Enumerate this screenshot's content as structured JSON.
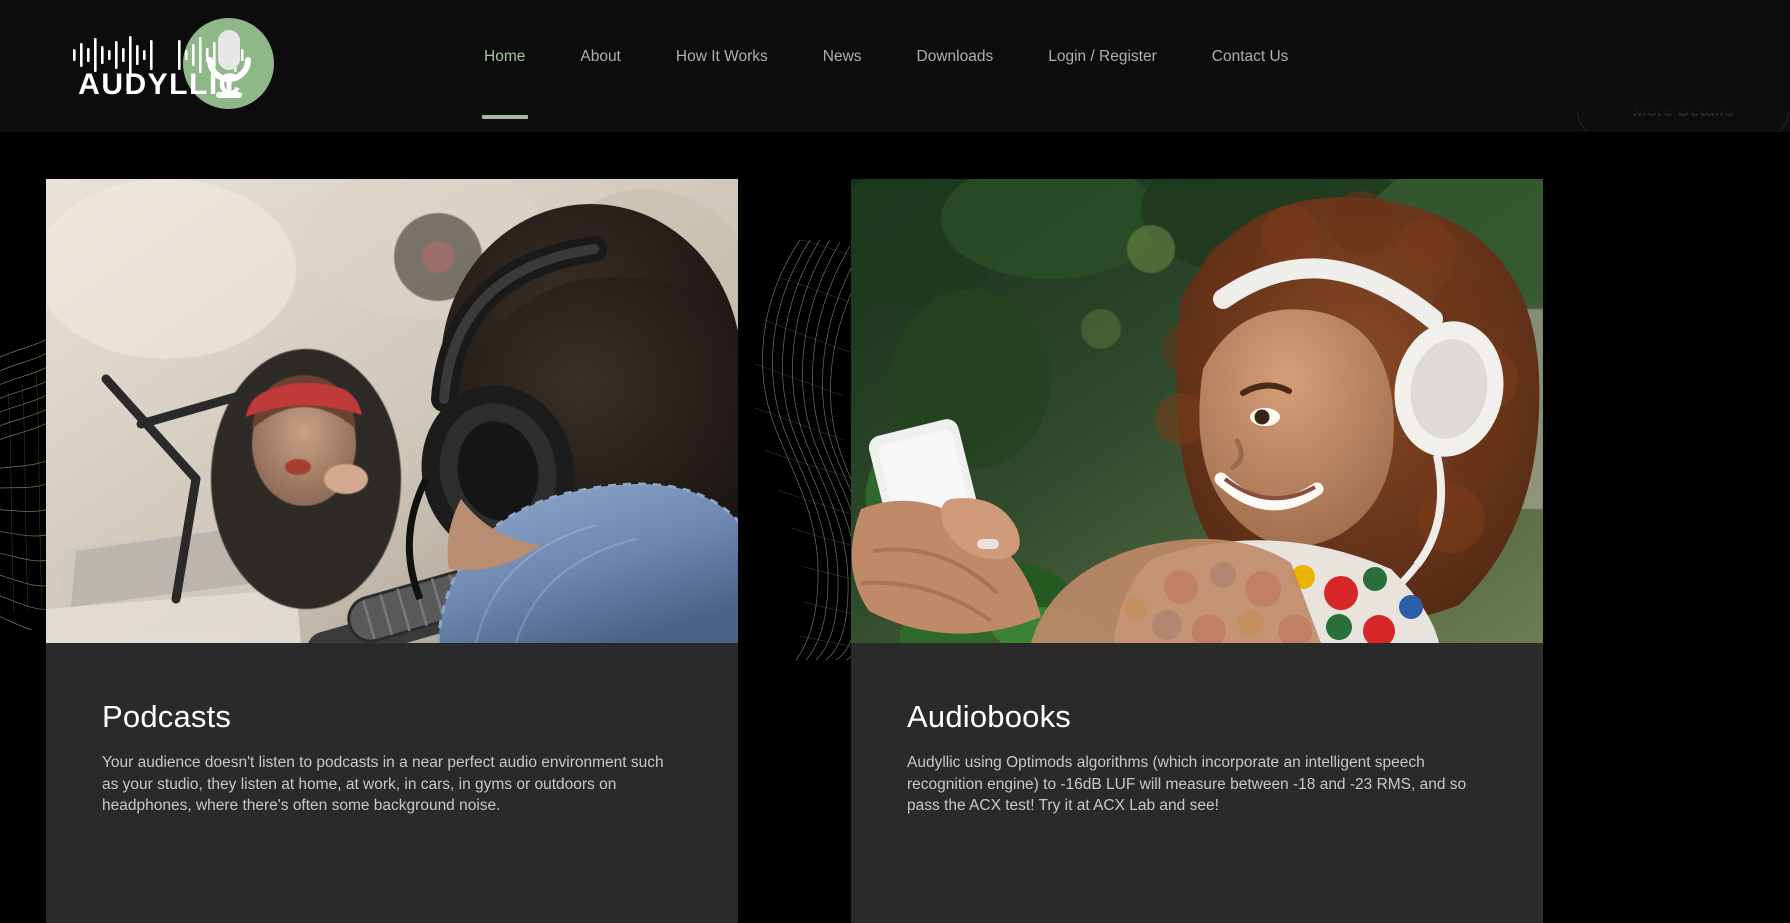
{
  "brand": {
    "name": "AUDYLLIC",
    "logo_icon": "microphone-waveform-icon",
    "accent_green": "#8fb888",
    "circle_color": "#8fb888"
  },
  "header": {
    "nav": [
      {
        "label": "Home",
        "active": true
      },
      {
        "label": "About",
        "active": false
      },
      {
        "label": "How It Works",
        "active": false
      },
      {
        "label": "News",
        "active": false
      },
      {
        "label": "Downloads",
        "active": false
      },
      {
        "label": "Login / Register",
        "active": false
      },
      {
        "label": "Contact Us",
        "active": false
      }
    ],
    "active_color": "#a8c5a0",
    "inactive_color": "#aeb0ad",
    "underline_color": "#9fbd98"
  },
  "hero": {
    "heading": "Don't Lose Your Hard-Won Audience!",
    "button_label": "More Details",
    "heading_color": "#1a1a18",
    "background": "#0d0d0d"
  },
  "cards": [
    {
      "title": "Podcasts",
      "body": "Your audience doesn't listen to podcasts in a near perfect audio environment such as your studio, they listen at home, at work, in cars, in gyms or outdoors on headphones, where there's often some background noise.",
      "image_alt": "podcast-studio-photo",
      "background": "#2a2a2a"
    },
    {
      "title": "Audiobooks",
      "body": "Audyllic using Optimods algorithms (which incorporate an intelligent speech recognition engine) to -16dB LUF will measure between -18 and -23 RMS, and so pass the ACX test! Try it at ACX Lab and see!",
      "image_alt": "audiobook-listener-photo",
      "background": "#2a2a2a"
    }
  ],
  "decor": {
    "wave_mesh_color": "#9cc194",
    "wave_left_name": "wave-mesh-left",
    "wave_mid_name": "wave-mesh-middle"
  }
}
